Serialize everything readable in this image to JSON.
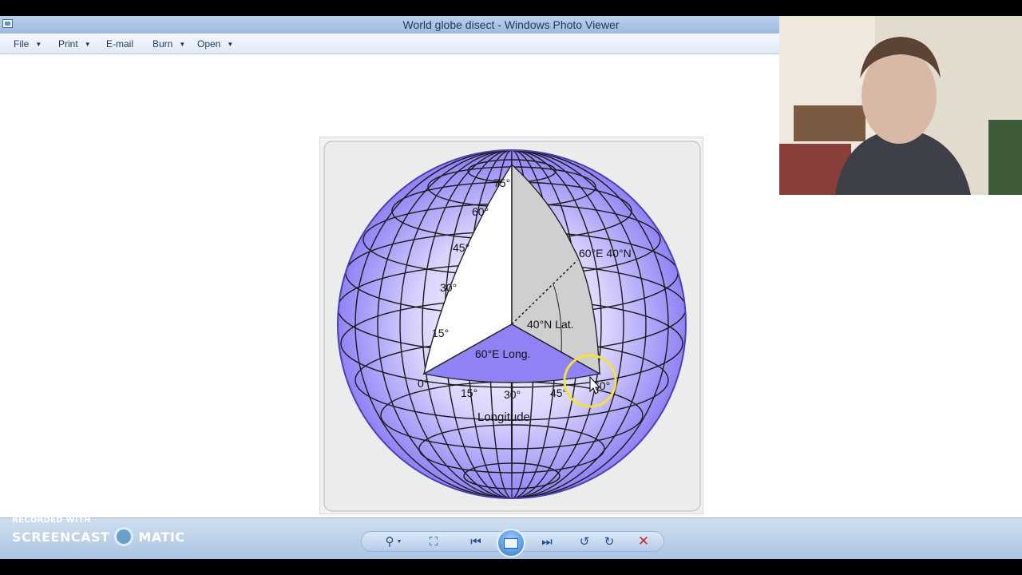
{
  "window": {
    "title": "World globe disect - Windows Photo Viewer"
  },
  "menu": {
    "items": [
      "File",
      "Print",
      "E-mail",
      "Burn",
      "Open"
    ]
  },
  "image": {
    "lat_labels": [
      "75°",
      "60°",
      "45°",
      "30°",
      "15°"
    ],
    "long_labels": [
      "0°",
      "15°",
      "30°",
      "45°",
      "60°"
    ],
    "point_label": "60°E 40°N",
    "lat_angle_label": "40°N Lat.",
    "long_angle_label": "60°E Long.",
    "axis_label": "Longitude"
  },
  "toolbar": {
    "icons": [
      "zoom-icon",
      "fit-window-icon",
      "previous-icon",
      "slideshow-icon",
      "next-icon",
      "rotate-counterclockwise-icon",
      "rotate-clockwise-icon",
      "delete-icon"
    ]
  },
  "watermark": {
    "line1": "RECORDED WITH",
    "brand_left": "SCREENCAST",
    "brand_right": "MATIC"
  },
  "colors": {
    "titlebar": "#b9d1ea",
    "toolbar": "#aac4e2",
    "globe_fill": "#8f82f5",
    "cursor_highlight": "#f2e23a"
  }
}
